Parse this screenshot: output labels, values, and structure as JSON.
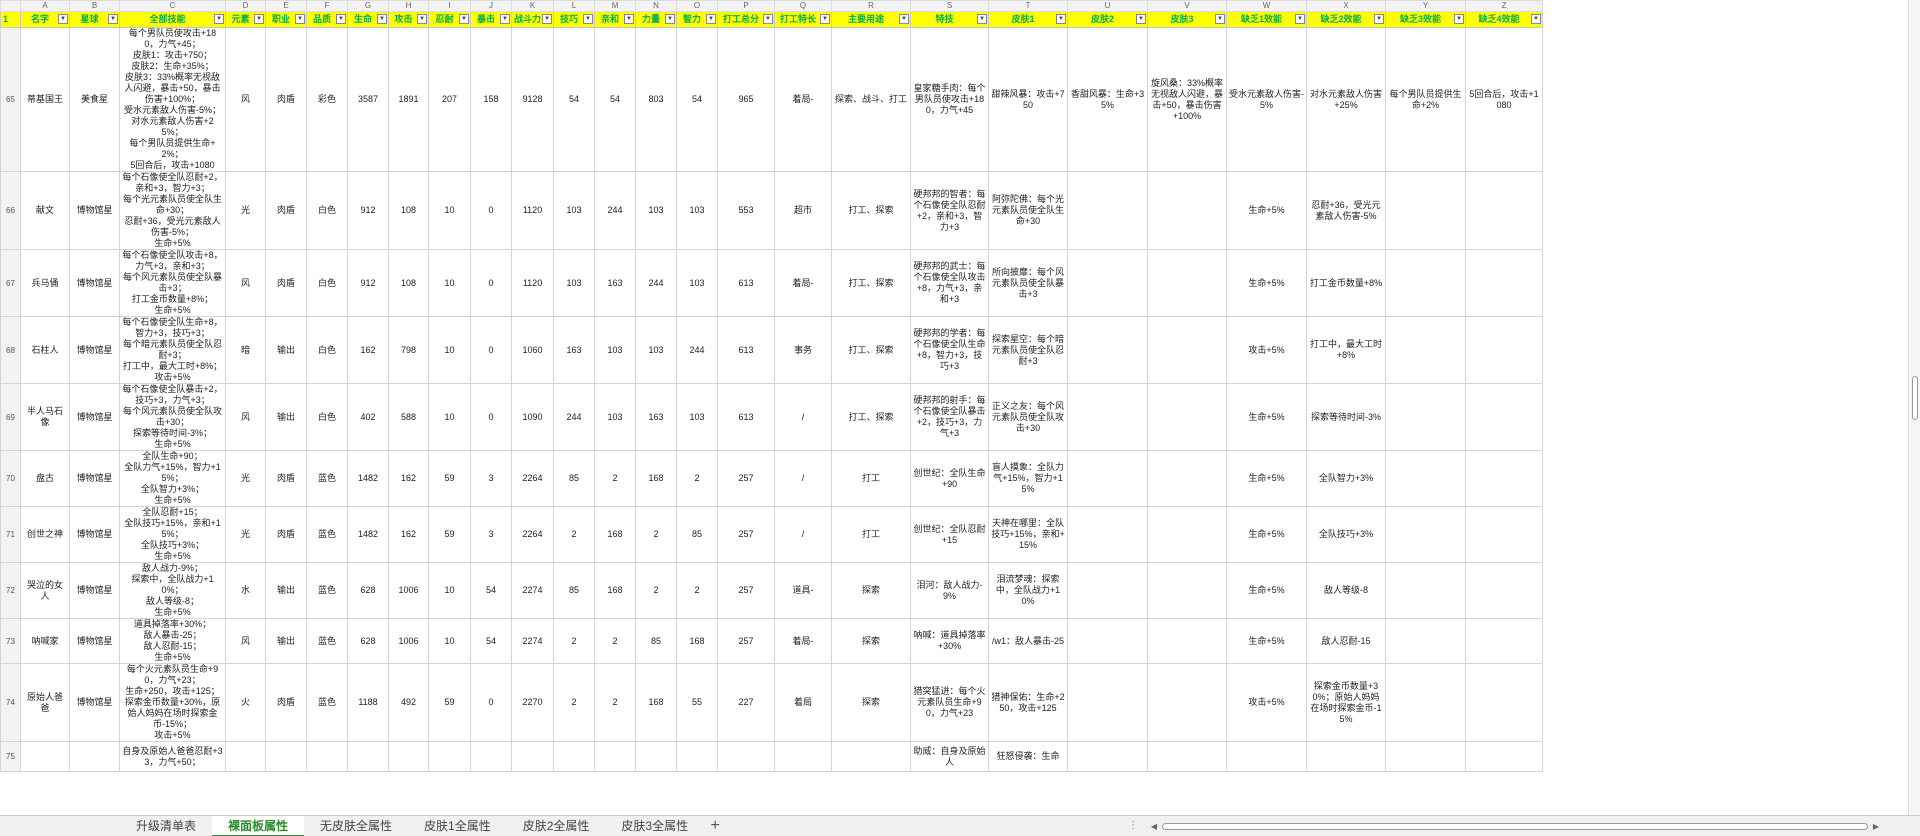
{
  "sheet": {
    "column_letters": [
      "A",
      "B",
      "C",
      "D",
      "E",
      "F",
      "G",
      "H",
      "I",
      "J",
      "K",
      "L",
      "M",
      "N",
      "O",
      "P",
      "Q",
      "R",
      "S",
      "T",
      "U",
      "V",
      "W",
      "X",
      "Y",
      "Z"
    ],
    "header_row_number": "1",
    "headers": [
      "名字",
      "星球",
      "全部技能",
      "元素",
      "职业",
      "品质",
      "生命",
      "攻击",
      "忍耐",
      "暴击",
      "战斗力",
      "技巧",
      "亲和",
      "力量",
      "智力",
      "打工总分",
      "打工特长",
      "主要用途",
      "特技",
      "皮肤1",
      "皮肤2",
      "皮肤3",
      "缺乏1效能",
      "缺乏2效能",
      "缺乏3效能",
      "缺乏4效能"
    ],
    "rows": [
      {
        "num": "65",
        "cells": [
          "蒂基国王",
          "美食星",
          "每个男队员使攻击+180，力气+45；\n皮肤1：攻击+750；\n皮肤2：生命+35%；\n皮肤3：33%概率无视敌人闪避，暴击+50，暴击伤害+100%；\n受水元素敌人伤害-5%；\n对水元素敌人伤害+25%；\n每个男队员提供生命+2%；\n5回合后，攻击+1080",
          "风",
          "肉盾",
          "彩色",
          "3587",
          "1891",
          "207",
          "158",
          "9128",
          "54",
          "54",
          "803",
          "54",
          "965",
          "着局-",
          "探索、战斗、打工",
          "皇家糖手肉：每个男队员使攻击+180，力气+45",
          "甜辣风暴：攻击+750",
          "香甜风暴：生命+35%",
          "旋风桑：33%概率无视敌人闪避，暴击+50，暴击伤害+100%",
          "受水元素敌人伤害-5%",
          "对水元素敌人伤害+25%",
          "每个男队员提供生命+2%",
          "5回合后，攻击+1080"
        ]
      },
      {
        "num": "66",
        "cells": [
          "献文",
          "博物馆星",
          "每个石像使全队忍耐+2，亲和+3，智力+3；\n每个光元素队员使全队生命+30；\n忍耐+36，受光元素敌人伤害-5%；\n生命+5%",
          "光",
          "肉盾",
          "白色",
          "912",
          "108",
          "10",
          "0",
          "1120",
          "103",
          "244",
          "103",
          "103",
          "553",
          "超市",
          "打工、探索",
          "硬邦邦的智者：每个石像使全队忍耐+2，亲和+3，智力+3",
          "阿弥陀佛：每个光元素队员使全队生命+30",
          "",
          "",
          "生命+5%",
          "忍耐+36，受光元素敌人伤害-5%",
          "",
          ""
        ]
      },
      {
        "num": "67",
        "cells": [
          "兵马俑",
          "博物馆星",
          "每个石像使全队攻击+8，力气+3，亲和+3；\n每个风元素队员使全队暴击+3；\n打工金币数量+8%；\n生命+5%",
          "风",
          "肉盾",
          "白色",
          "912",
          "108",
          "10",
          "0",
          "1120",
          "103",
          "163",
          "244",
          "103",
          "613",
          "着局-",
          "打工、探索",
          "硬邦邦的武士：每个石像使全队攻击+8，力气+3，亲和+3",
          "所向披靡：每个风元素队员使全队暴击+3",
          "",
          "",
          "生命+5%",
          "打工金币数量+8%",
          "",
          ""
        ]
      },
      {
        "num": "68",
        "cells": [
          "石柱人",
          "博物馆星",
          "每个石像使全队生命+8，智力+3，技巧+3；\n每个暗元素队员使全队忍耐+3；\n打工中，最大工时+8%；\n攻击+5%",
          "暗",
          "输出",
          "白色",
          "162",
          "798",
          "10",
          "0",
          "1060",
          "163",
          "103",
          "103",
          "244",
          "613",
          "事务",
          "打工、探索",
          "硬邦邦的学者：每个石像使全队生命+8，智力+3，技巧+3",
          "探索星空：每个暗元素队员使全队忍耐+3",
          "",
          "",
          "攻击+5%",
          "打工中，最大工时+8%",
          "",
          ""
        ]
      },
      {
        "num": "69",
        "cells": [
          "半人马石像",
          "博物馆星",
          "每个石像使全队暴击+2，技巧+3，力气+3；\n每个风元素队员使全队攻击+30；\n探索等待时间-3%；\n生命+5%",
          "风",
          "输出",
          "白色",
          "402",
          "588",
          "10",
          "0",
          "1090",
          "244",
          "103",
          "163",
          "103",
          "613",
          "/",
          "打工、探索",
          "硬邦邦的射手：每个石像使全队暴击+2，技巧+3，力气+3",
          "正义之友：每个风元素队员使全队攻击+30",
          "",
          "",
          "生命+5%",
          "探索等待时间-3%",
          "",
          ""
        ]
      },
      {
        "num": "70",
        "cells": [
          "盘古",
          "博物馆星",
          "全队生命+90；\n全队力气+15%，智力+15%；\n全队智力+3%；\n生命+5%",
          "光",
          "肉盾",
          "蓝色",
          "1482",
          "162",
          "59",
          "3",
          "2264",
          "85",
          "2",
          "168",
          "2",
          "257",
          "/",
          "打工",
          "创世纪：全队生命+90",
          "盲人摸象：全队力气+15%，智力+15%",
          "",
          "",
          "生命+5%",
          "全队智力+3%",
          "",
          ""
        ]
      },
      {
        "num": "71",
        "cells": [
          "创世之神",
          "博物馆星",
          "全队忍耐+15；\n全队技巧+15%，亲和+15%；\n全队技巧+3%；\n生命+5%",
          "光",
          "肉盾",
          "蓝色",
          "1482",
          "162",
          "59",
          "3",
          "2264",
          "2",
          "168",
          "2",
          "85",
          "257",
          "/",
          "打工",
          "创世纪：全队忍耐+15",
          "天神在哪里：全队技巧+15%，亲和+15%",
          "",
          "",
          "生命+5%",
          "全队技巧+3%",
          "",
          ""
        ]
      },
      {
        "num": "72",
        "cells": [
          "哭泣的女人",
          "博物馆星",
          "敌人战力-9%；\n探索中，全队战力+10%；\n敌人等级-8；\n生命+5%",
          "水",
          "输出",
          "蓝色",
          "628",
          "1006",
          "10",
          "54",
          "2274",
          "85",
          "168",
          "2",
          "2",
          "257",
          "道具-",
          "探索",
          "泪河：敌人战力-9%",
          "泪流梦魂：探索中，全队战力+10%",
          "",
          "",
          "生命+5%",
          "敌人等级-8",
          "",
          ""
        ]
      },
      {
        "num": "73",
        "cells": [
          "呐喊家",
          "博物馆星",
          "道具掉落率+30%；\n敌人暴击-25；\n敌人忍耐-15；\n生命+5%",
          "风",
          "输出",
          "蓝色",
          "628",
          "1006",
          "10",
          "54",
          "2274",
          "2",
          "2",
          "85",
          "168",
          "257",
          "着局-",
          "探索",
          "呐喊：道具掉落率+30%",
          "/w1：敌人暴击-25",
          "",
          "",
          "生命+5%",
          "敌人忍耐-15",
          "",
          ""
        ]
      },
      {
        "num": "74",
        "cells": [
          "原始人爸爸",
          "博物馆星",
          "每个火元素队员生命+90，力气+23；\n生命+250，攻击+125；\n探索金币数量+30%，原始人妈妈在场时探索金币-15%；\n攻击+5%",
          "火",
          "肉盾",
          "蓝色",
          "1188",
          "492",
          "59",
          "0",
          "2270",
          "2",
          "2",
          "168",
          "55",
          "227",
          "着局",
          "探索",
          "猎突猛进：每个火元素队员生命+90，力气+23",
          "猎神保佑：生命+250，攻击+125",
          "",
          "",
          "攻击+5%",
          "探索金币数量+30%；原始人妈妈在场时探索金币-15%",
          "",
          ""
        ]
      },
      {
        "num": "75",
        "cells": [
          "",
          "",
          "自身及原始人爸爸忍耐+33，力气+50；",
          "",
          "",
          "",
          "",
          "",
          "",
          "",
          "",
          "",
          "",
          "",
          "",
          "",
          "",
          "",
          "助威：自身及原始人",
          "狂怒侵袭：生命",
          "",
          "",
          "",
          "",
          "",
          ""
        ]
      }
    ]
  },
  "tabs": [
    {
      "label": "升级清单表",
      "active": false
    },
    {
      "label": "裸面板属性",
      "active": true
    },
    {
      "label": "无皮肤全属性",
      "active": false
    },
    {
      "label": "皮肤1全属性",
      "active": false
    },
    {
      "label": "皮肤2全属性",
      "active": false
    },
    {
      "label": "皮肤3全属性",
      "active": false
    }
  ],
  "add_tab_label": "+",
  "colors": {
    "header_fill": "#ffff00",
    "header_text": "#00b050",
    "active_tab_text": "#2e8b30",
    "grid_line": "#d4d4d4"
  },
  "icons": {
    "filter_button": "dropdown-filter-icon",
    "add_sheet": "plus-icon",
    "scroll_left": "triangle-left-icon",
    "scroll_right": "triangle-right-icon"
  }
}
